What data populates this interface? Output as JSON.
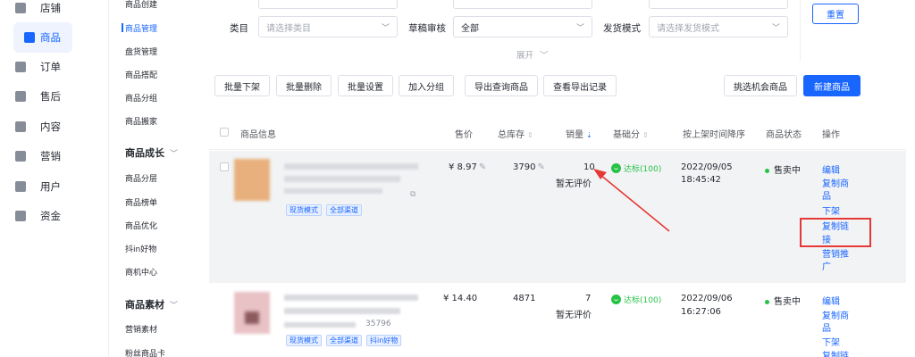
{
  "nav_primary": [
    {
      "label": "店铺",
      "icon": "store-icon"
    },
    {
      "label": "商品",
      "icon": "goods-icon",
      "active": true
    },
    {
      "label": "订单",
      "icon": "order-icon"
    },
    {
      "label": "售后",
      "icon": "aftersale-icon"
    },
    {
      "label": "内容",
      "icon": "content-icon"
    },
    {
      "label": "营销",
      "icon": "marketing-icon"
    },
    {
      "label": "用户",
      "icon": "user-icon"
    },
    {
      "label": "资金",
      "icon": "wallet-icon"
    }
  ],
  "nav_secondary": {
    "items_top": [
      "商品创建",
      "商品管理",
      "盘货管理",
      "商品搭配",
      "商品分组",
      "商品搬家"
    ],
    "group_growth": {
      "title": "商品成长",
      "items": [
        "商品分层",
        "商品榜单",
        "商品优化",
        "抖in好物",
        "商机中心"
      ]
    },
    "group_material": {
      "title": "商品素材",
      "items": [
        "营销素材",
        "粉丝商品卡"
      ]
    }
  },
  "filters": {
    "category_label": "类目",
    "category_placeholder": "请选择类目",
    "draft_label": "草稿审核",
    "draft_value": "全部",
    "ship_label": "发货模式",
    "ship_placeholder": "请选择发货模式",
    "expand_label": "展开",
    "reset_label": "重置"
  },
  "toolbar": {
    "batch_off": "批量下架",
    "batch_delete": "批量删除",
    "batch_setting": "批量设置",
    "add_group": "加入分组",
    "export_query": "导出查询商品",
    "export_records": "查看导出记录",
    "pick_chance": "挑选机会商品",
    "create_goods": "新建商品"
  },
  "table": {
    "headers": {
      "info": "商品信息",
      "price": "售价",
      "stock": "总库存",
      "sales": "销量",
      "score": "基础分",
      "time": "按上架时间降序",
      "status": "商品状态",
      "action": "操作"
    },
    "rows": [
      {
        "price": "¥ 8.97",
        "stock": "3790",
        "sales": "10",
        "review": "暂无评价",
        "score": "达标(100)",
        "date": "2022/09/05",
        "time": "18:45:42",
        "status": "售卖中",
        "tags": [
          "现货模式",
          "全部渠道"
        ],
        "actions": [
          "编辑",
          "复制商",
          "品",
          "下架",
          "复制链",
          "接",
          "营销推",
          "广"
        ]
      },
      {
        "price": "¥ 14.40",
        "stock": "4871",
        "sales": "7",
        "review": "暂无评价",
        "score": "达标(100)",
        "date": "2022/09/06",
        "time": "16:27:06",
        "status": "售卖中",
        "id_fragment": "35796",
        "tags": [
          "现货模式",
          "全部渠道",
          "抖in好物"
        ],
        "actions": [
          "编辑",
          "复制商",
          "品",
          "下架",
          "复制链"
        ]
      }
    ]
  },
  "colors": {
    "accent": "#1966ff",
    "success": "#27c346",
    "annotation": "#e53935"
  }
}
